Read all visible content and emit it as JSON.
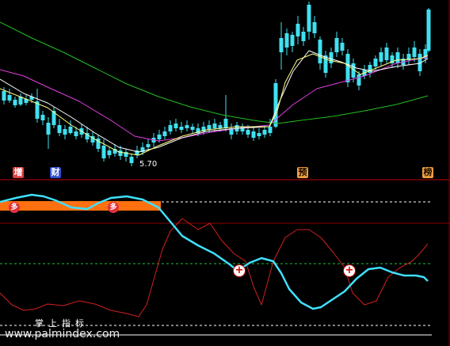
{
  "colors": {
    "background": "#000000",
    "up_candle": "#ff4040",
    "down_candle": "#40e0f0",
    "ma_yellow": "#ffff80",
    "ma_magenta": "#e040e0",
    "ma_green": "#20c020",
    "ma_white": "#ffffff",
    "oscillator_cyan": "#40e0ff",
    "oscillator_red": "#d02020",
    "band_orange": "#ff7010",
    "divider_red": "#c00000"
  },
  "price_panel": {
    "low_label": "5.70",
    "event_tags": [
      {
        "text": "增",
        "icon": "increase-tag-icon",
        "color": "#e04040"
      },
      {
        "text": "财",
        "icon": "finance-tag-icon",
        "color": "#4060e0"
      },
      {
        "text": "预",
        "icon": "forecast-tag-icon",
        "color": "#f0a040"
      },
      {
        "text": "榜",
        "icon": "ranking-tag-icon",
        "color": "#f0a040"
      }
    ]
  },
  "indicator_panel": {
    "name": "掌上指标",
    "signal_badges": [
      {
        "text": "多",
        "icon": "bull-signal-icon"
      },
      {
        "text": "多",
        "icon": "bull-signal-icon"
      }
    ],
    "cross_markers": [
      {
        "icon": "plus-cross-icon"
      },
      {
        "icon": "plus-cross-icon"
      }
    ]
  },
  "watermark": "www.palmindex.com"
}
